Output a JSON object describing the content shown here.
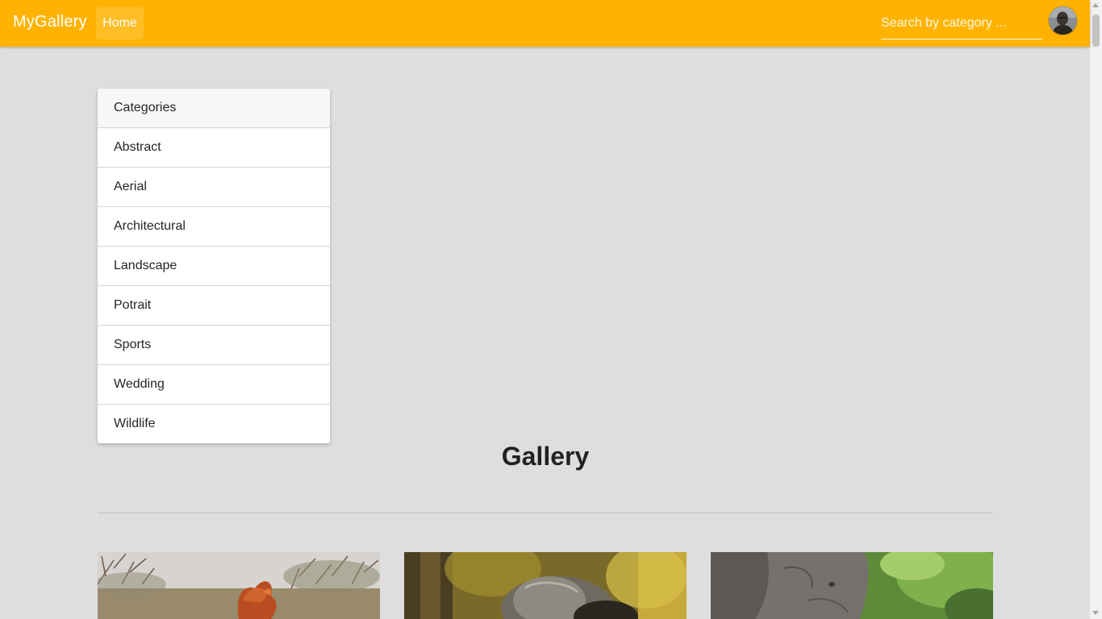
{
  "navbar": {
    "brand": "MyGallery",
    "home_label": "Home",
    "search_placeholder": "Search by category ...",
    "background": "#ffb300"
  },
  "sidebar": {
    "header": "Categories",
    "items": [
      {
        "label": "Abstract"
      },
      {
        "label": "Aerial"
      },
      {
        "label": "Architectural"
      },
      {
        "label": "Landscape"
      },
      {
        "label": "Potrait"
      },
      {
        "label": "Sports"
      },
      {
        "label": "Wedding"
      },
      {
        "label": "Wildlife"
      }
    ]
  },
  "main": {
    "title": "Gallery",
    "photos": [
      {
        "icon": "savanna-dust-photo"
      },
      {
        "icon": "primate-photo"
      },
      {
        "icon": "elephant-photo"
      }
    ]
  }
}
